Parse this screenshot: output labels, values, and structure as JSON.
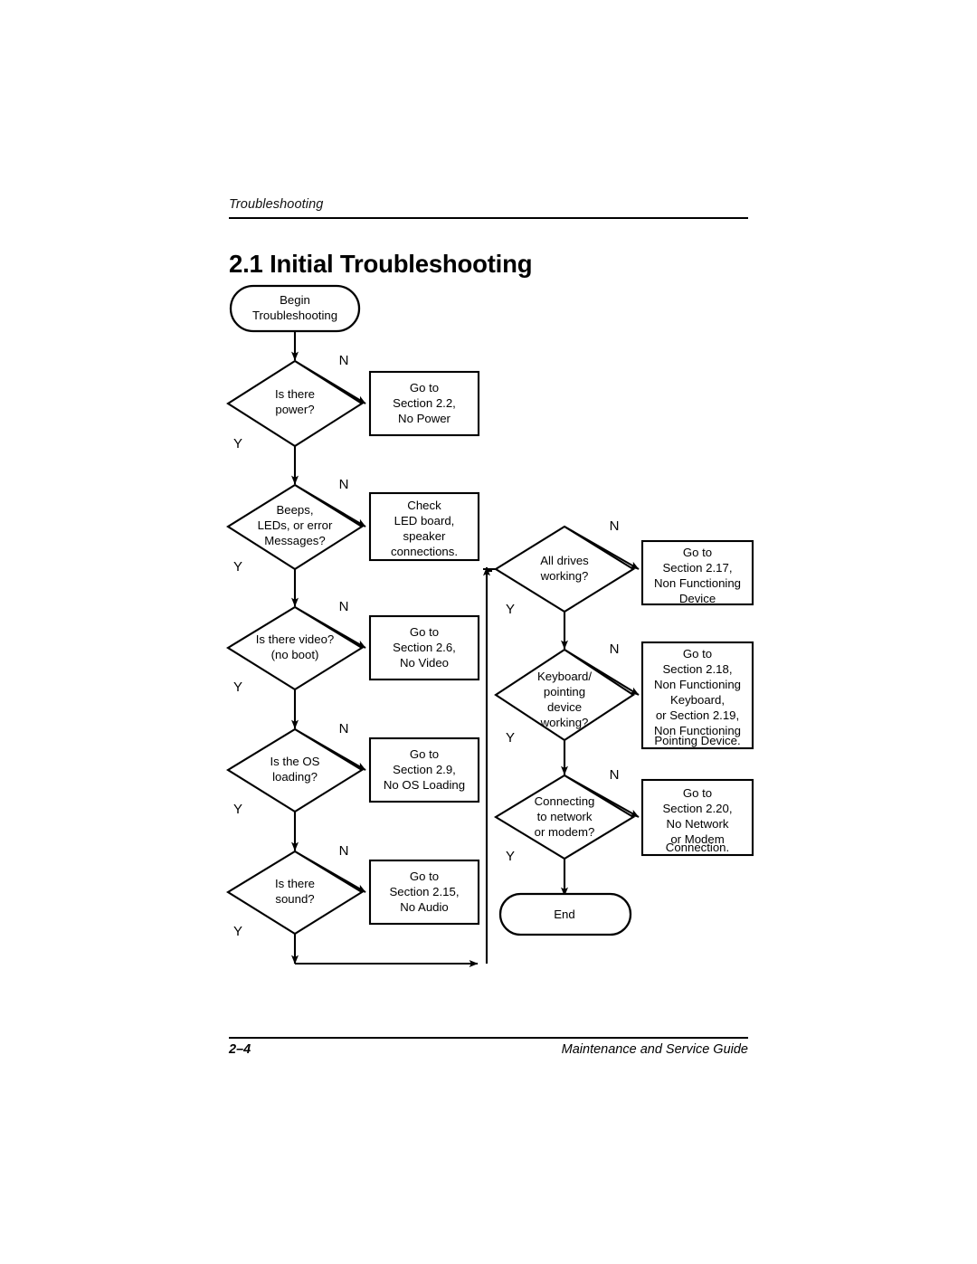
{
  "page": {
    "running_head": "Troubleshooting",
    "section_title": "2.1 Initial Troubleshooting",
    "folio": "2–4",
    "guide_title": "Maintenance and Service Guide"
  },
  "labels": {
    "yes": "Y",
    "no": "N"
  },
  "flowchart": {
    "type": "flowchart",
    "orientation": "two-column",
    "start": {
      "id": "begin",
      "shape": "terminator",
      "lines": [
        "Begin",
        "Troubleshooting"
      ]
    },
    "end": {
      "id": "end",
      "shape": "terminator",
      "lines": [
        "End"
      ]
    },
    "decisions": [
      {
        "id": "power",
        "column": "left",
        "lines": [
          "Is there",
          "power?"
        ],
        "no_target": "go-2-2",
        "yes_target": "beeps"
      },
      {
        "id": "beeps",
        "column": "left",
        "lines": [
          "Beeps,",
          "LEDs, or error",
          "Messages?"
        ],
        "no_target": "check-led",
        "yes_target": "video"
      },
      {
        "id": "video",
        "column": "left",
        "lines": [
          "Is there video?",
          "(no boot)"
        ],
        "no_target": "go-2-6",
        "yes_target": "os"
      },
      {
        "id": "os",
        "column": "left",
        "lines": [
          "Is the OS",
          "loading?"
        ],
        "no_target": "go-2-9",
        "yes_target": "sound"
      },
      {
        "id": "sound",
        "column": "left",
        "lines": [
          "Is there",
          "sound?"
        ],
        "no_target": "go-2-15",
        "yes_target": "drives"
      },
      {
        "id": "drives",
        "column": "right",
        "lines": [
          "All drives",
          "working?"
        ],
        "no_target": "go-2-17",
        "yes_target": "keyboard"
      },
      {
        "id": "keyboard",
        "column": "right",
        "lines": [
          "Keyboard/",
          "pointing",
          "device",
          "working?"
        ],
        "no_target": "go-2-18",
        "yes_target": "network"
      },
      {
        "id": "network",
        "column": "right",
        "lines": [
          "Connecting",
          "to network",
          "or modem?"
        ],
        "no_target": "go-2-20",
        "yes_target": "end"
      }
    ],
    "processes": [
      {
        "id": "go-2-2",
        "column": "left",
        "lines": [
          "Go to",
          "Section 2.2,",
          "No Power"
        ]
      },
      {
        "id": "check-led",
        "column": "left",
        "lines": [
          "Check",
          "LED board,",
          "speaker",
          "connections."
        ]
      },
      {
        "id": "go-2-6",
        "column": "left",
        "lines": [
          "Go to",
          "Section 2.6,",
          "No Video"
        ]
      },
      {
        "id": "go-2-9",
        "column": "left",
        "lines": [
          "Go to",
          "Section 2.9,",
          "No OS Loading"
        ]
      },
      {
        "id": "go-2-15",
        "column": "left",
        "lines": [
          "Go to",
          "Section 2.15,",
          "No Audio"
        ]
      },
      {
        "id": "go-2-17",
        "column": "right",
        "lines": [
          "Go to",
          "Section 2.17,",
          "Non Functioning",
          "Device"
        ]
      },
      {
        "id": "go-2-18",
        "column": "right",
        "lines": [
          "Go to",
          "Section 2.18,",
          "Non Functioning",
          "Keyboard,",
          "or Section 2.19,",
          "Non Functioning",
          "Pointing Device."
        ]
      },
      {
        "id": "go-2-20",
        "column": "right",
        "lines": [
          "Go to",
          "Section 2.20,",
          "No Network",
          "or Modem",
          "Connection."
        ]
      }
    ]
  }
}
